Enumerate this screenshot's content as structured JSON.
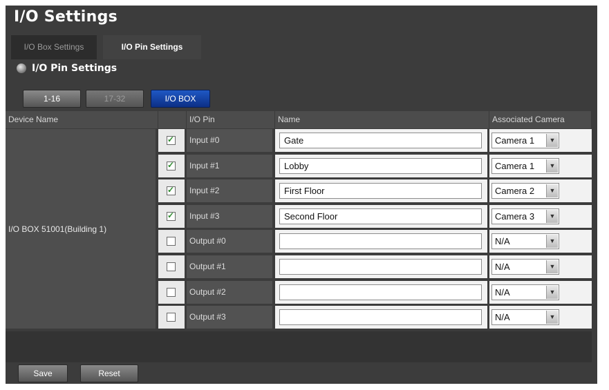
{
  "window": {
    "title": "I/O Settings"
  },
  "tabs": [
    {
      "label": "I/O Box Settings",
      "active": false
    },
    {
      "label": "I/O Pin Settings",
      "active": true
    }
  ],
  "section": {
    "title": "I/O Pin Settings",
    "icon": "bulb-icon"
  },
  "ranges": [
    {
      "label": "1-16",
      "state": "normal"
    },
    {
      "label": "17-32",
      "state": "disabled"
    },
    {
      "label": "I/O BOX",
      "state": "selected"
    }
  ],
  "table": {
    "headers": {
      "device": "Device Name",
      "pin": "I/O Pin",
      "name": "Name",
      "camera": "Associated Camera"
    },
    "device_name": "I/O BOX 51001(Building 1)",
    "rows": [
      {
        "checked": true,
        "pin": "Input #0",
        "name": "Gate",
        "camera": "Camera 1"
      },
      {
        "checked": true,
        "pin": "Input #1",
        "name": "Lobby",
        "camera": "Camera 1"
      },
      {
        "checked": true,
        "pin": "Input #2",
        "name": "First Floor",
        "camera": "Camera 2"
      },
      {
        "checked": true,
        "pin": "Input #3",
        "name": "Second Floor",
        "camera": "Camera 3"
      },
      {
        "checked": false,
        "pin": "Output #0",
        "name": "",
        "camera": "N/A"
      },
      {
        "checked": false,
        "pin": "Output #1",
        "name": "",
        "camera": "N/A"
      },
      {
        "checked": false,
        "pin": "Output #2",
        "name": "",
        "camera": "N/A"
      },
      {
        "checked": false,
        "pin": "Output #3",
        "name": "",
        "camera": "N/A"
      }
    ]
  },
  "actions": {
    "save_label": "Save",
    "reset_label": "Reset"
  },
  "colors": {
    "accent_blue": "#1a4fb8",
    "background": "#3c3c3c",
    "check_green": "#2d8a2d"
  }
}
